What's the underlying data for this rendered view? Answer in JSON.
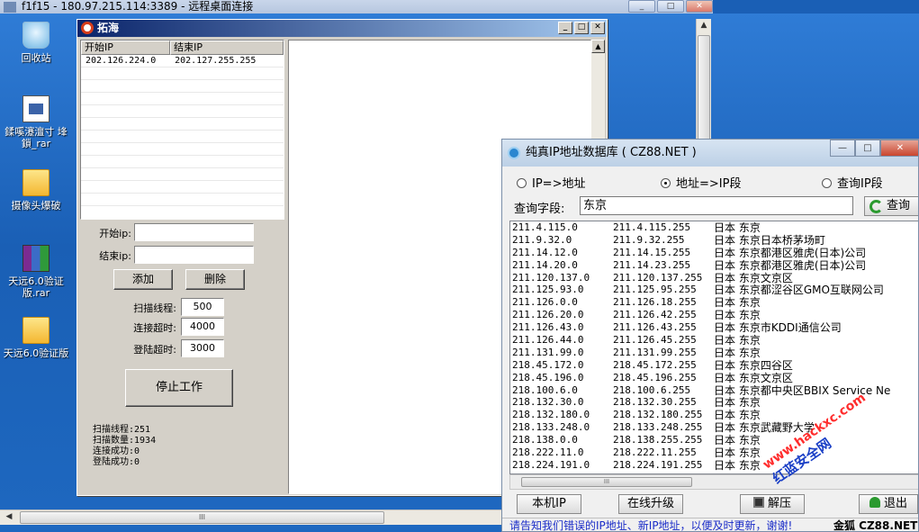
{
  "remote_desktop": {
    "title": "f1f15 - 180.97.215.114:3389 - 远程桌面连接",
    "btn_min": "_",
    "btn_max": "□",
    "btn_close": "✕"
  },
  "desktop_icons": [
    {
      "label": "回收站",
      "icon": "recycle-bin-icon"
    },
    {
      "label": "鍒嗘瀽澶寸 埄鎻_rar",
      "icon": "document-icon"
    },
    {
      "label": "摄像头爆破",
      "icon": "folder-icon"
    },
    {
      "label": "天远6.0验证版.rar",
      "icon": "rar-archive-icon"
    },
    {
      "label": "天远6.0验证版",
      "icon": "folder-icon"
    }
  ],
  "scanner": {
    "title": "拓海",
    "table_headers": [
      "开始IP",
      "结束IP"
    ],
    "rows": [
      {
        "start": "202.126.224.0",
        "end": "202.127.255.255"
      }
    ],
    "start_ip_label": "开始ip:",
    "end_ip_label": "结束ip:",
    "start_ip_value": "",
    "end_ip_value": "",
    "add_button": "添加",
    "delete_button": "删除",
    "threads_label": "扫描线程:",
    "threads_value": "500",
    "connect_timeout_label": "连接超时:",
    "connect_timeout_value": "4000",
    "login_timeout_label": "登陆超时:",
    "login_timeout_value": "3000",
    "stop_button": "停止工作",
    "status_lines": [
      "扫描线程:251",
      "扫描数量:1934",
      "连接成功:0",
      "登陆成功:0"
    ]
  },
  "cz88": {
    "title": "纯真IP地址数据库 ( CZ88.NET )",
    "radio_ip_to_addr": "IP=>地址",
    "radio_addr_to_ip": "地址=>IP段",
    "radio_query_ip": "查询IP段",
    "selected_radio": "addr_to_ip",
    "query_label": "查询字段:",
    "query_value": "东京",
    "query_button": "查询",
    "results": [
      {
        "start": "211.4.115.0",
        "end": "211.4.115.255",
        "loc": "日本 东京"
      },
      {
        "start": "211.9.32.0",
        "end": "211.9.32.255",
        "loc": "日本 东京日本桥茅场町"
      },
      {
        "start": "211.14.12.0",
        "end": "211.14.15.255",
        "loc": "日本 东京都港区雅虎(日本)公司"
      },
      {
        "start": "211.14.20.0",
        "end": "211.14.23.255",
        "loc": "日本 东京都港区雅虎(日本)公司"
      },
      {
        "start": "211.120.137.0",
        "end": "211.120.137.255",
        "loc": "日本 东京文京区"
      },
      {
        "start": "211.125.93.0",
        "end": "211.125.95.255",
        "loc": "日本 东京都涩谷区GMO互联网公司"
      },
      {
        "start": "211.126.0.0",
        "end": "211.126.18.255",
        "loc": "日本 东京"
      },
      {
        "start": "211.126.20.0",
        "end": "211.126.42.255",
        "loc": "日本 东京"
      },
      {
        "start": "211.126.43.0",
        "end": "211.126.43.255",
        "loc": "日本 东京市KDDI通信公司"
      },
      {
        "start": "211.126.44.0",
        "end": "211.126.45.255",
        "loc": "日本 东京"
      },
      {
        "start": "211.131.99.0",
        "end": "211.131.99.255",
        "loc": "日本 东京"
      },
      {
        "start": "218.45.172.0",
        "end": "218.45.172.255",
        "loc": "日本 东京四谷区"
      },
      {
        "start": "218.45.196.0",
        "end": "218.45.196.255",
        "loc": "日本 东京文京区"
      },
      {
        "start": "218.100.6.0",
        "end": "218.100.6.255",
        "loc": "日本 东京都中央区BBIX Service Ne"
      },
      {
        "start": "218.132.30.0",
        "end": "218.132.30.255",
        "loc": "日本 东京"
      },
      {
        "start": "218.132.180.0",
        "end": "218.132.180.255",
        "loc": "日本 东京"
      },
      {
        "start": "218.133.248.0",
        "end": "218.133.248.255",
        "loc": "日本 东京武藏野大学"
      },
      {
        "start": "218.138.0.0",
        "end": "218.138.255.255",
        "loc": "日本 东京"
      },
      {
        "start": "218.222.11.0",
        "end": "218.222.11.255",
        "loc": "日本 东京"
      },
      {
        "start": "218.224.191.0",
        "end": "218.224.191.255",
        "loc": "日本 东京"
      }
    ],
    "btn_local_ip": "本机IP",
    "btn_online_upgrade": "在线升级",
    "btn_extract": "解压",
    "btn_exit": "退出",
    "status_hint": "请告知我们错误的IP地址、新IP地址，以便及时更新，谢谢!",
    "status_author": "金狐 CZ88.NET"
  },
  "watermark": {
    "line1": "www.hackxc.com",
    "line2": "红蓝安全网"
  }
}
